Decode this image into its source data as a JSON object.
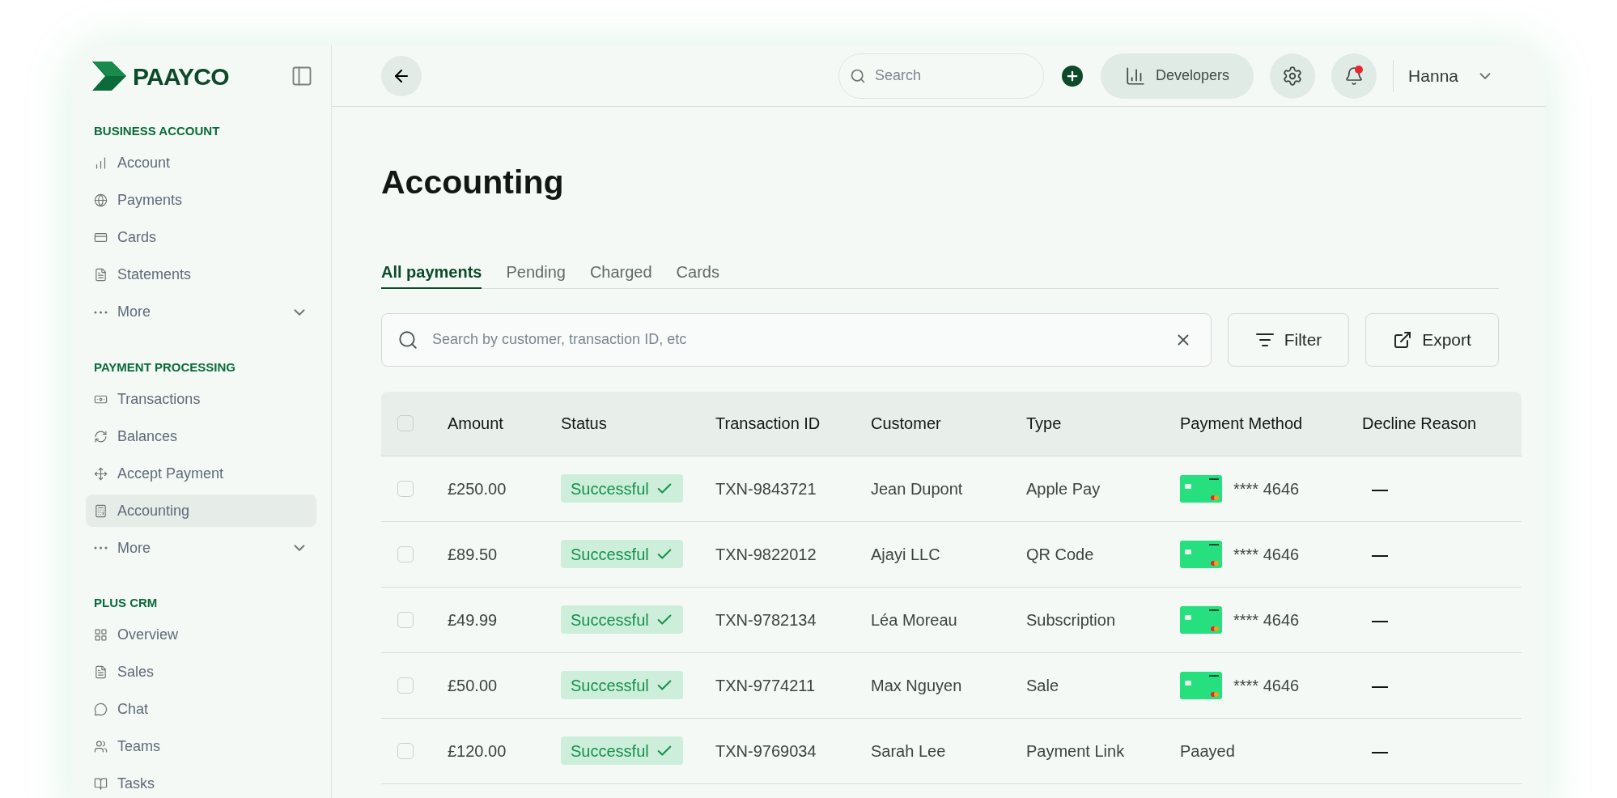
{
  "logo": {
    "text": "PAAYCO"
  },
  "sidebar": {
    "sections": [
      {
        "title": "BUSINESS ACCOUNT",
        "items": [
          {
            "label": "Account",
            "selected": false,
            "expandable": false
          },
          {
            "label": "Payments",
            "selected": false,
            "expandable": false
          },
          {
            "label": "Cards",
            "selected": false,
            "expandable": false
          },
          {
            "label": "Statements",
            "selected": false,
            "expandable": false
          },
          {
            "label": "More",
            "selected": false,
            "expandable": true
          }
        ]
      },
      {
        "title": "PAYMENT PROCESSING",
        "items": [
          {
            "label": "Transactions",
            "selected": false,
            "expandable": false
          },
          {
            "label": "Balances",
            "selected": false,
            "expandable": false
          },
          {
            "label": "Accept Payment",
            "selected": false,
            "expandable": false
          },
          {
            "label": "Accounting",
            "selected": true,
            "expandable": false
          },
          {
            "label": "More",
            "selected": false,
            "expandable": true
          }
        ]
      },
      {
        "title": "PLUS CRM",
        "items": [
          {
            "label": "Overview",
            "selected": false,
            "expandable": false
          },
          {
            "label": "Sales",
            "selected": false,
            "expandable": false
          },
          {
            "label": "Chat",
            "selected": false,
            "expandable": false
          },
          {
            "label": "Teams",
            "selected": false,
            "expandable": false
          },
          {
            "label": "Tasks",
            "selected": false,
            "expandable": false
          }
        ]
      }
    ]
  },
  "topbar": {
    "search_placeholder": "Search",
    "developers": "Developers",
    "notification": true,
    "user": "Hanna"
  },
  "page_title": "Accounting",
  "tabs": [
    {
      "label": "All payments",
      "selected": true
    },
    {
      "label": "Pending",
      "selected": false
    },
    {
      "label": "Charged",
      "selected": false
    },
    {
      "label": "Cards",
      "selected": false
    }
  ],
  "table_search": {
    "placeholder": "Search by customer, transaction ID, etc"
  },
  "buttons": {
    "filter": "Filter",
    "export": "Export"
  },
  "table": {
    "header_checked": false,
    "columns": [
      "Amount",
      "Status",
      "Transaction ID",
      "Customer",
      "Type",
      "Payment Method",
      "Decline Reason"
    ],
    "rows": [
      {
        "checked": false,
        "amount": "£250.00",
        "status": "Successful",
        "txn": "TXN-9843721",
        "customer": "Jean Dupont",
        "type": "Apple Pay",
        "method": {
          "kind": "card",
          "text": "**** 4646"
        },
        "decline": "—"
      },
      {
        "checked": false,
        "amount": "£89.50",
        "status": "Successful",
        "txn": "TXN-9822012",
        "customer": "Ajayi LLC",
        "type": "QR Code",
        "method": {
          "kind": "card",
          "text": "**** 4646"
        },
        "decline": "—"
      },
      {
        "checked": false,
        "amount": "£49.99",
        "status": "Successful",
        "txn": "TXN-9782134",
        "customer": "Léa Moreau",
        "type": "Subscription",
        "method": {
          "kind": "card",
          "text": "**** 4646"
        },
        "decline": "—"
      },
      {
        "checked": false,
        "amount": "£50.00",
        "status": "Successful",
        "txn": "TXN-9774211",
        "customer": "Max Nguyen",
        "type": "Sale",
        "method": {
          "kind": "card",
          "text": "**** 4646"
        },
        "decline": "—"
      },
      {
        "checked": false,
        "amount": "£120.00",
        "status": "Successful",
        "txn": "TXN-9769034",
        "customer": "Sarah Lee",
        "type": "Payment Link",
        "method": {
          "kind": "text",
          "text": "Paayed"
        },
        "decline": "—"
      }
    ]
  }
}
